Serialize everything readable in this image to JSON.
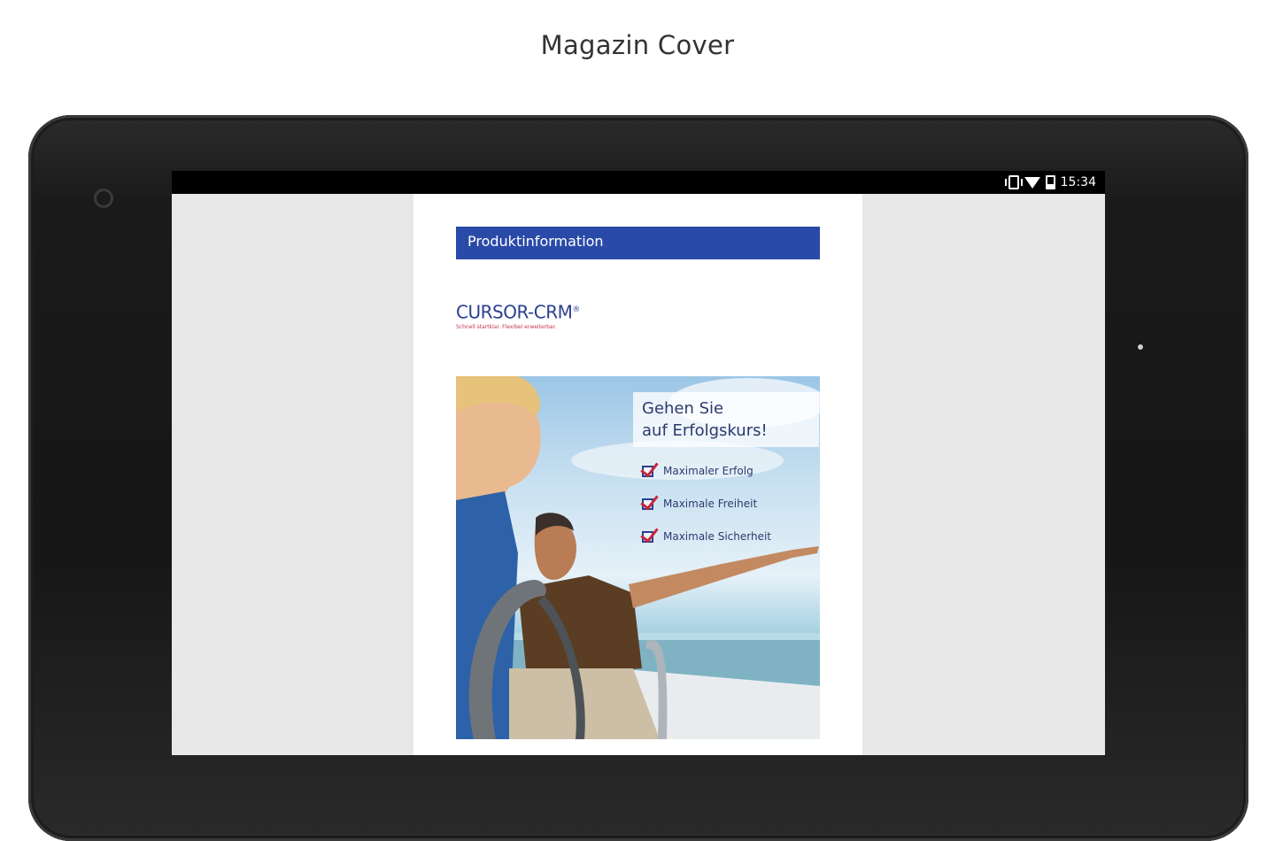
{
  "page": {
    "heading": "Magazin Cover"
  },
  "status_bar": {
    "time": "15:34",
    "icons": [
      "vibrate-icon",
      "wifi-icon",
      "battery-icon"
    ]
  },
  "document": {
    "header_label": "Produktinformation",
    "logo_text": "CURSOR-CRM",
    "logo_trademark": "®",
    "logo_tagline": "Schnell startklar. Flexibel erweiterbar.",
    "cover": {
      "headline_line1": "Gehen Sie",
      "headline_line2": "auf Erfolgskurs!",
      "checklist": [
        "Maximaler Erfolg",
        "Maximale Freiheit",
        "Maximale Sicherheit"
      ]
    }
  },
  "colors": {
    "header_bar": "#2a4aa8",
    "logo_blue": "#2a3f8f",
    "check_red": "#c8283f",
    "tablet_body": "#1a1a1a",
    "screen_bg": "#e8e8e8"
  }
}
